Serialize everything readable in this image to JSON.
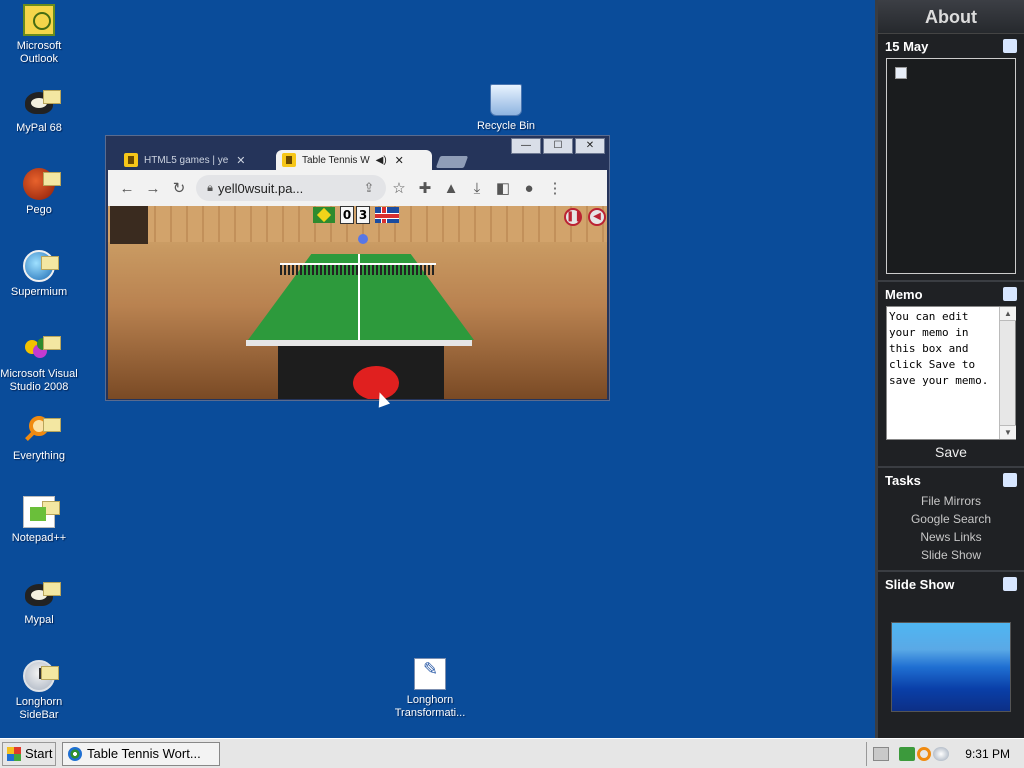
{
  "desktop": {
    "icons": [
      {
        "label": "Microsoft Outlook"
      },
      {
        "label": "MyPal 68"
      },
      {
        "label": "Pego"
      },
      {
        "label": "Supermium"
      },
      {
        "label": "Microsoft Visual Studio 2008"
      },
      {
        "label": "Everything"
      },
      {
        "label": "Notepad++"
      },
      {
        "label": "Mypal"
      },
      {
        "label": "Longhorn SideBar"
      },
      {
        "label": "Recycle Bin"
      },
      {
        "label": "Longhorn Transformati..."
      }
    ]
  },
  "browser": {
    "tabs": [
      {
        "label": "HTML5 games | ye"
      },
      {
        "label": "Table Tennis W"
      }
    ],
    "tab_close": "✕",
    "url": "yell0wsuit.pa...",
    "game": {
      "score_left": "0",
      "score_right": "3"
    }
  },
  "sidebar": {
    "title": "About",
    "date": "15 May",
    "memo_header": "Memo",
    "memo_text": "You can edit your memo in this box and click Save to save your memo.",
    "save_label": "Save",
    "tasks_header": "Tasks",
    "tasks": [
      "File Mirrors",
      "Google Search",
      "News Links",
      "Slide Show"
    ],
    "slideshow_header": "Slide Show"
  },
  "taskbar": {
    "start_label": "Start",
    "task_label": "Table Tennis Wort...",
    "clock": "9:31 PM"
  }
}
